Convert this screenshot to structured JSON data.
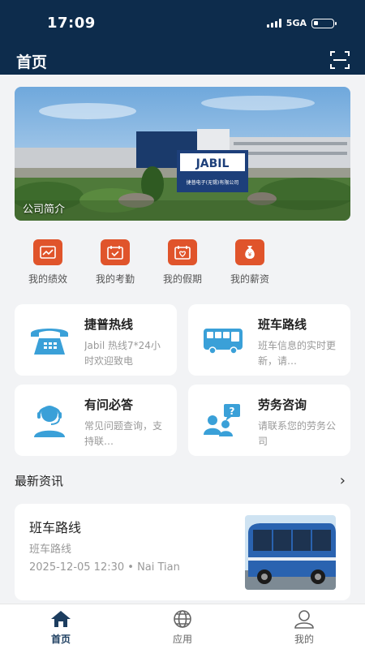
{
  "status_bar": {
    "time": "17:09",
    "network": "5GA"
  },
  "header": {
    "title": "首页",
    "scan_icon": "scan-icon"
  },
  "banner": {
    "caption": "公司简介",
    "sign_text": "JABIL",
    "sign_subtext": "捷普电子(无锡)有限公司"
  },
  "quick_entries": [
    {
      "label": "我的绩效",
      "icon": "performance-icon"
    },
    {
      "label": "我的考勤",
      "icon": "attendance-icon"
    },
    {
      "label": "我的假期",
      "icon": "vacation-icon"
    },
    {
      "label": "我的薪资",
      "icon": "salary-icon"
    }
  ],
  "cards": [
    {
      "title": "捷普热线",
      "desc": "Jabil 热线7*24小时欢迎致电",
      "icon": "telephone-icon"
    },
    {
      "title": "班车路线",
      "desc": "班车信息的实时更新，请…",
      "icon": "bus-icon"
    },
    {
      "title": "有问必答",
      "desc": "常见问题查询，支持联…",
      "icon": "customer-service-icon"
    },
    {
      "title": "劳务咨询",
      "desc": "请联系您的劳务公司",
      "icon": "consult-icon"
    }
  ],
  "news": {
    "section_title": "最新资讯",
    "items": [
      {
        "title": "班车路线",
        "subtitle": "班车路线",
        "meta": "2025-12-05 12:30  •  Nai Tian"
      }
    ]
  },
  "bottom_nav": [
    {
      "label": "首页",
      "icon": "home-icon",
      "active": true
    },
    {
      "label": "应用",
      "icon": "globe-icon",
      "active": false
    },
    {
      "label": "我的",
      "icon": "user-icon",
      "active": false
    }
  ],
  "colors": {
    "header": "#0d2c4c",
    "accent_orange": "#e0542b",
    "icon_blue": "#3aa0d8"
  }
}
